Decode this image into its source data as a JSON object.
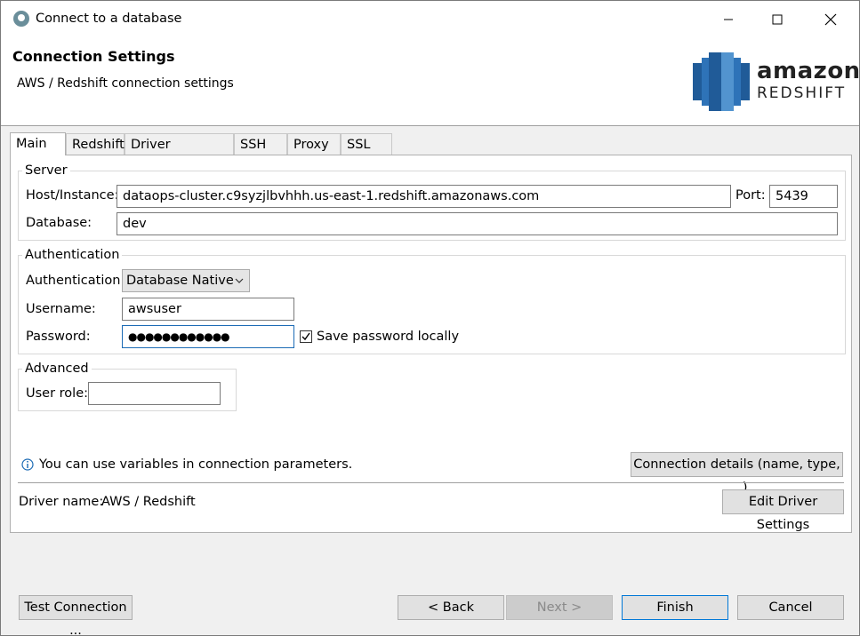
{
  "window": {
    "title": "Connect to a database"
  },
  "header": {
    "title": "Connection Settings",
    "subtitle": "AWS / Redshift connection settings",
    "logo_word1": "amazon",
    "logo_word2": "REDSHIFT"
  },
  "tabs": [
    {
      "label": "Main"
    },
    {
      "label": "Redshift"
    },
    {
      "label": "Driver properties"
    },
    {
      "label": "SSH"
    },
    {
      "label": "Proxy"
    },
    {
      "label": "SSL"
    }
  ],
  "server": {
    "legend": "Server",
    "host_label": "Host/Instance:",
    "host_value": "dataops-cluster.c9syzjlbvhhh.us-east-1.redshift.amazonaws.com",
    "port_label": "Port:",
    "port_value": "5439",
    "database_label": "Database:",
    "database_value": "dev"
  },
  "auth": {
    "legend": "Authentication",
    "auth_label": "Authentication:",
    "auth_value": "Database Native",
    "username_label": "Username:",
    "username_value": "awsuser",
    "password_label": "Password:",
    "password_value": "●●●●●●●●●●●●",
    "save_password_label": "Save password locally",
    "save_password_checked": true
  },
  "advanced": {
    "legend": "Advanced",
    "user_role_label": "User role:",
    "user_role_value": ""
  },
  "info": {
    "text": "You can use variables in connection parameters."
  },
  "connection_details_button": "Connection details (name, type, ... )",
  "driver": {
    "label": "Driver name:",
    "value": "AWS / Redshift",
    "edit_button": "Edit Driver Settings"
  },
  "footer": {
    "test_connection": "Test Connection ...",
    "back": "< Back",
    "next": "Next >",
    "finish": "Finish",
    "cancel": "Cancel"
  },
  "colors": {
    "logo_blue": "#205b98",
    "logo_light": "#5294cf",
    "focus": "#1c6bb5"
  }
}
